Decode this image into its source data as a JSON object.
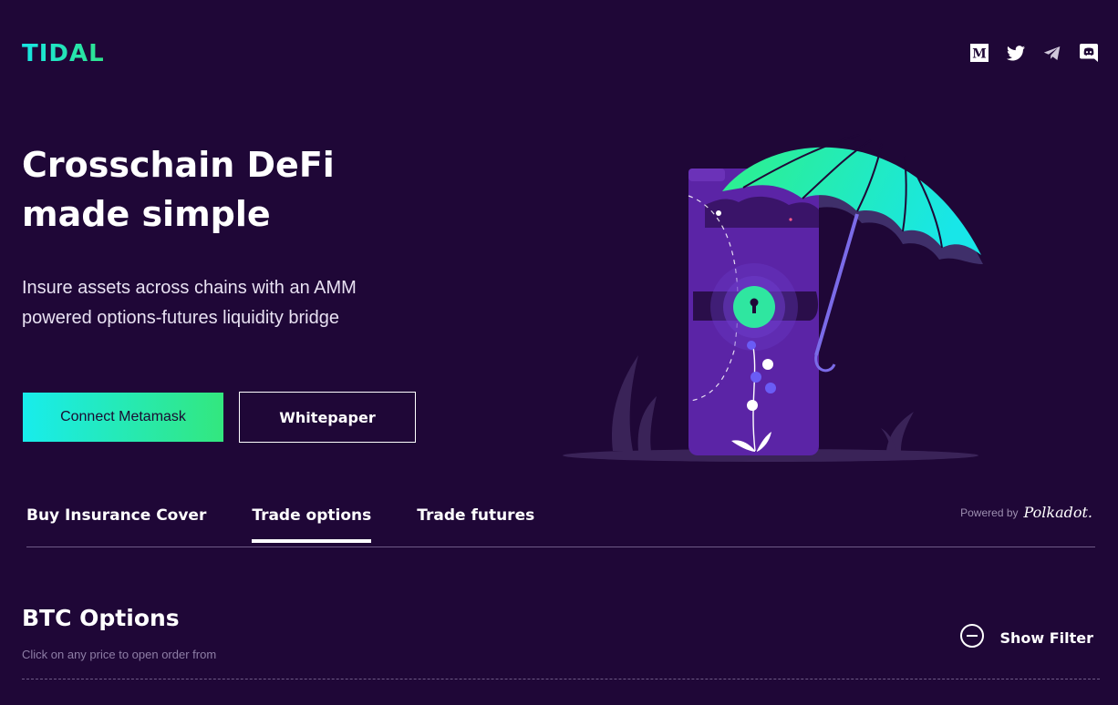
{
  "header": {
    "logo": "TIDAL",
    "social": [
      {
        "name": "medium-icon"
      },
      {
        "name": "twitter-icon"
      },
      {
        "name": "telegram-icon"
      },
      {
        "name": "discord-icon"
      }
    ]
  },
  "hero": {
    "title_line1": "Crosschain DeFi",
    "title_line2": "made simple",
    "subtitle_line1": "Insure assets across chains with an AMM",
    "subtitle_line2": "powered options-futures liquidity bridge",
    "connect_label": "Connect Metamask",
    "whitepaper_label": "Whitepaper"
  },
  "tabs": [
    {
      "label": "Buy Insurance Cover",
      "active": false
    },
    {
      "label": "Trade options",
      "active": true
    },
    {
      "label": "Trade futures",
      "active": false
    }
  ],
  "powered": {
    "label": "Powered by",
    "brand": "Polkadot."
  },
  "section": {
    "title": "BTC Options",
    "hint": "Click on any price to open order from",
    "filter_label": "Show Filter"
  },
  "colors": {
    "background": "#1f0737",
    "accent_cyan": "#18ecec",
    "accent_green": "#33e77e"
  }
}
